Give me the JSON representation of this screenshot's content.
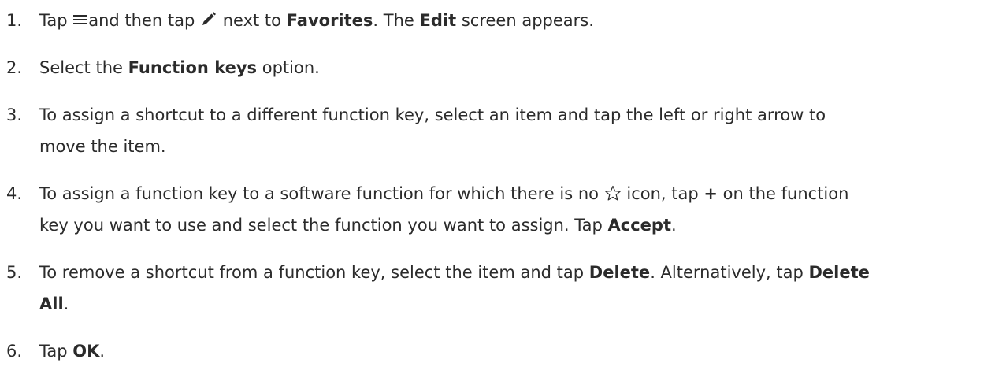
{
  "steps": [
    {
      "number": "1.",
      "t1": "Tap",
      "menu_icon": "menu-icon",
      "t2": "and then tap",
      "pencil_icon": "pencil-icon",
      "t3": "next to",
      "b1": "Favorites",
      "t4": ". The",
      "b2": "Edit",
      "t5": "screen appears."
    },
    {
      "number": "2.",
      "t1": "Select the",
      "b1": "Function keys",
      "t2": "option."
    },
    {
      "number": "3.",
      "line1": "To assign a shortcut to a different function key, select an item and tap the left or right arrow to",
      "line2": "move the item."
    },
    {
      "number": "4.",
      "t1": "To assign a function key to a software function for which there is no",
      "star_icon": "star-outline-icon",
      "t2": "icon, tap",
      "b1": "+",
      "t3": "on the function",
      "t4": "key you want to use and select the function you want to assign. Tap",
      "b2": "Accept",
      "t5": "."
    },
    {
      "number": "5.",
      "t1": "To remove a shortcut from a function key, select the item and tap",
      "b1": "Delete",
      "t2": ". Alternatively, tap",
      "b2": "Delete",
      "b3": "All",
      "t3": "."
    },
    {
      "number": "6.",
      "t1": "Tap",
      "b1": "OK",
      "t2": "."
    }
  ]
}
